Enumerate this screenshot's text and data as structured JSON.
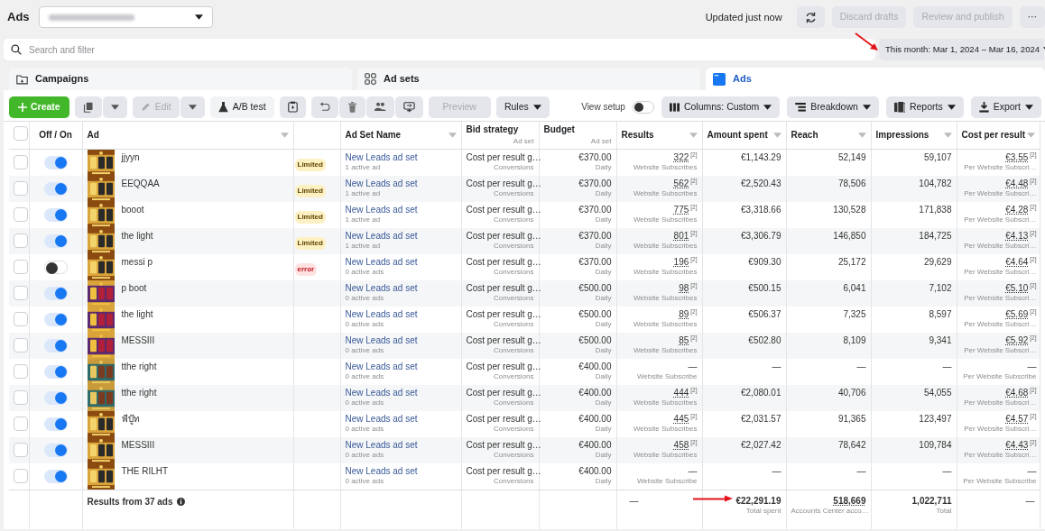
{
  "header": {
    "title": "Ads",
    "status": "Updated just now",
    "buttons": [
      {
        "label": "Discard drafts",
        "disabled": true
      },
      {
        "label": "Review and publish",
        "disabled": true
      }
    ],
    "more": "···"
  },
  "search": {
    "placeholder": "Search and filter"
  },
  "date_range": "This month: Mar 1, 2024 – Mar 16, 2024",
  "level_tabs": [
    {
      "label": "Campaigns",
      "kind": "folder",
      "selected": false
    },
    {
      "label": "Ad sets",
      "kind": "grid",
      "selected": false
    },
    {
      "label": "Ads",
      "kind": "ad",
      "selected": true
    }
  ],
  "toolbar": {
    "create": "Create",
    "edit": {
      "label": "Edit",
      "disabled": true
    },
    "ab_test": "A/B test",
    "preview": {
      "label": "Preview",
      "disabled": true
    },
    "rules": "Rules",
    "view_setup": {
      "label": "View setup",
      "on": false
    },
    "columns": "Columns: Custom",
    "breakdown": "Breakdown",
    "reports": "Reports",
    "export": "Export"
  },
  "table": {
    "select_all": {
      "checked": false
    },
    "columns": [
      {
        "label": "Off / On",
        "menu": false
      },
      {
        "label": "Ad",
        "menu": true
      },
      {
        "label": "Ad Set Name",
        "menu": true
      },
      {
        "label": "Bid strategy",
        "sub": "Ad set",
        "menu": false
      },
      {
        "label": "Budget",
        "sub": "Ad set",
        "menu": false
      },
      {
        "label": "Results",
        "menu": true
      },
      {
        "label": "Amount spent",
        "menu": true
      },
      {
        "label": "Reach",
        "menu": true
      },
      {
        "label": "Impressions",
        "menu": true
      },
      {
        "label": "Cost per result",
        "menu": true
      }
    ],
    "rows": [
      {
        "checked": false,
        "on": true,
        "ad": "jjyyn",
        "delivery": {
          "label": "Limited",
          "kind": "limited"
        },
        "ad_set": "New Leads ad set",
        "ad_set_sub": "1 active ad",
        "bid": "Cost per result g…",
        "bid_sub": "Conversions",
        "budget": "€370.00",
        "budget_sub": "Daily",
        "results": "322",
        "results_note": "[2]",
        "results_sub": "Website Subscribes",
        "spent": "€1,143.29",
        "reach": "52,149",
        "impressions": "59,107",
        "cost": "€3.55",
        "cost_note": "[2]",
        "cost_sub": "Per Website Subscri…"
      },
      {
        "checked": false,
        "on": true,
        "ad": "EEQQAA",
        "delivery": {
          "label": "Limited",
          "kind": "limited"
        },
        "ad_set": "New Leads ad set",
        "ad_set_sub": "1 active ad",
        "bid": "Cost per result g…",
        "bid_sub": "Conversions",
        "budget": "€370.00",
        "budget_sub": "Daily",
        "results": "562",
        "results_note": "[2]",
        "results_sub": "Website Subscribes",
        "spent": "€2,520.43",
        "reach": "78,506",
        "impressions": "104,782",
        "cost": "€4.48",
        "cost_note": "[2]",
        "cost_sub": "Per Website Subscri…"
      },
      {
        "checked": false,
        "on": true,
        "ad": "booot",
        "delivery": {
          "label": "Limited",
          "kind": "limited"
        },
        "ad_set": "New Leads ad set",
        "ad_set_sub": "1 active ad",
        "bid": "Cost per result g…",
        "bid_sub": "Conversions",
        "budget": "€370.00",
        "budget_sub": "Daily",
        "results": "775",
        "results_note": "[2]",
        "results_sub": "Website Subscribes",
        "spent": "€3,318.66",
        "reach": "130,528",
        "impressions": "171,838",
        "cost": "€4.28",
        "cost_note": "[2]",
        "cost_sub": "Per Website Subscri…"
      },
      {
        "checked": false,
        "on": true,
        "ad": "the light",
        "delivery": {
          "label": "Limited",
          "kind": "limited"
        },
        "ad_set": "New Leads ad set",
        "ad_set_sub": "1 active ad",
        "bid": "Cost per result g…",
        "bid_sub": "Conversions",
        "budget": "€370.00",
        "budget_sub": "Daily",
        "results": "801",
        "results_note": "[2]",
        "results_sub": "Website Subscribes",
        "spent": "€3,306.79",
        "reach": "146,850",
        "impressions": "184,725",
        "cost": "€4.13",
        "cost_note": "[2]",
        "cost_sub": "Per Website Subscri…"
      },
      {
        "checked": false,
        "on": false,
        "ad": "messi p",
        "delivery": {
          "label": "error",
          "kind": "error"
        },
        "ad_set": "New Leads ad set",
        "ad_set_sub": "0 active ads",
        "bid": "Cost per result g…",
        "bid_sub": "Conversions",
        "budget": "€370.00",
        "budget_sub": "Daily",
        "results": "196",
        "results_note": "[2]",
        "results_sub": "Website Subscribes",
        "spent": "€909.30",
        "reach": "25,172",
        "impressions": "29,629",
        "cost": "€4.64",
        "cost_note": "[2]",
        "cost_sub": "Per Website Subscri…"
      },
      {
        "checked": false,
        "on": true,
        "ad": "p boot",
        "ad_set": "New Leads ad set",
        "ad_set_sub": "0 active ads",
        "bid": "Cost per result g…",
        "bid_sub": "Conversions",
        "budget": "€500.00",
        "budget_sub": "Daily",
        "results": "98",
        "results_note": "[2]",
        "results_sub": "Website Subscribes",
        "spent": "€500.15",
        "reach": "6,041",
        "impressions": "7,102",
        "cost": "€5.10",
        "cost_note": "[2]",
        "cost_sub": "Per Website Subscri…"
      },
      {
        "checked": false,
        "on": true,
        "ad": "the light",
        "ad_set": "New Leads ad set",
        "ad_set_sub": "0 active ads",
        "bid": "Cost per result g…",
        "bid_sub": "Conversions",
        "budget": "€500.00",
        "budget_sub": "Daily",
        "results": "89",
        "results_note": "[2]",
        "results_sub": "Website Subscribes",
        "spent": "€506.37",
        "reach": "7,325",
        "impressions": "8,597",
        "cost": "€5.69",
        "cost_note": "[2]",
        "cost_sub": "Per Website Subscri…"
      },
      {
        "checked": false,
        "on": true,
        "ad": "MESSIII",
        "ad_set": "New Leads ad set",
        "ad_set_sub": "0 active ads",
        "bid": "Cost per result g…",
        "bid_sub": "Conversions",
        "budget": "€500.00",
        "budget_sub": "Daily",
        "results": "85",
        "results_note": "[2]",
        "results_sub": "Website Subscribes",
        "spent": "€502.80",
        "reach": "8,109",
        "impressions": "9,341",
        "cost": "€5.92",
        "cost_note": "[2]",
        "cost_sub": "Per Website Subscri…"
      },
      {
        "checked": false,
        "on": true,
        "ad": "tthe right",
        "ad_set": "New Leads ad set",
        "ad_set_sub": "0 active ads",
        "bid": "Cost per result g…",
        "bid_sub": "Conversions",
        "budget": "€400.00",
        "budget_sub": "Daily",
        "results": "—",
        "results_sub": "Website Subscribe",
        "spent": "—",
        "reach": "—",
        "impressions": "—",
        "cost": "—",
        "cost_sub": "Per Website Subscribe"
      },
      {
        "checked": false,
        "on": true,
        "ad": "tthe right",
        "ad_set": "New Leads ad set",
        "ad_set_sub": "0 active ads",
        "bid": "Cost per result g…",
        "bid_sub": "Conversions",
        "budget": "€400.00",
        "budget_sub": "Daily",
        "results": "444",
        "results_note": "[2]",
        "results_sub": "Website Subscribes",
        "spent": "€2,080.01",
        "reach": "40,706",
        "impressions": "54,055",
        "cost": "€4.68",
        "cost_note": "[2]",
        "cost_sub": "Per Website Subscri…"
      },
      {
        "checked": false,
        "on": true,
        "ad": "พีบู๊ท",
        "ad_set": "New Leads ad set",
        "ad_set_sub": "0 active ads",
        "bid": "Cost per result g…",
        "bid_sub": "Conversions",
        "budget": "€400.00",
        "budget_sub": "Daily",
        "results": "445",
        "results_note": "[2]",
        "results_sub": "Website Subscribes",
        "spent": "€2,031.57",
        "reach": "91,365",
        "impressions": "123,497",
        "cost": "€4.57",
        "cost_note": "[2]",
        "cost_sub": "Per Website Subscri…"
      },
      {
        "checked": false,
        "on": true,
        "ad": "MESSIII",
        "ad_set": "New Leads ad set",
        "ad_set_sub": "0 active ads",
        "bid": "Cost per result g…",
        "bid_sub": "Conversions",
        "budget": "€400.00",
        "budget_sub": "Daily",
        "results": "458",
        "results_note": "[2]",
        "results_sub": "Website Subscribes",
        "spent": "€2,027.42",
        "reach": "78,642",
        "impressions": "109,784",
        "cost": "€4.43",
        "cost_note": "[2]",
        "cost_sub": "Per Website Subscri…"
      },
      {
        "checked": false,
        "on": true,
        "ad": "THE RILHT",
        "ad_set": "New Leads ad set",
        "ad_set_sub": "0 active ads",
        "bid": "Cost per result g…",
        "bid_sub": "Conversions",
        "budget": "€400.00",
        "budget_sub": "Daily",
        "results": "—",
        "results_sub": "Website Subscribe",
        "spent": "—",
        "reach": "—",
        "impressions": "—",
        "cost": "—",
        "cost_sub": "Per Website Subscribe"
      }
    ],
    "footer": {
      "label": "Results from 37 ads",
      "results": "—",
      "spent": "€22,291.19",
      "spent_sub": "Total spent",
      "reach": "518,669",
      "reach_sub": "Accounts Center acco…",
      "impressions": "1,022,711",
      "impressions_sub": "Total",
      "cost": "—"
    }
  }
}
